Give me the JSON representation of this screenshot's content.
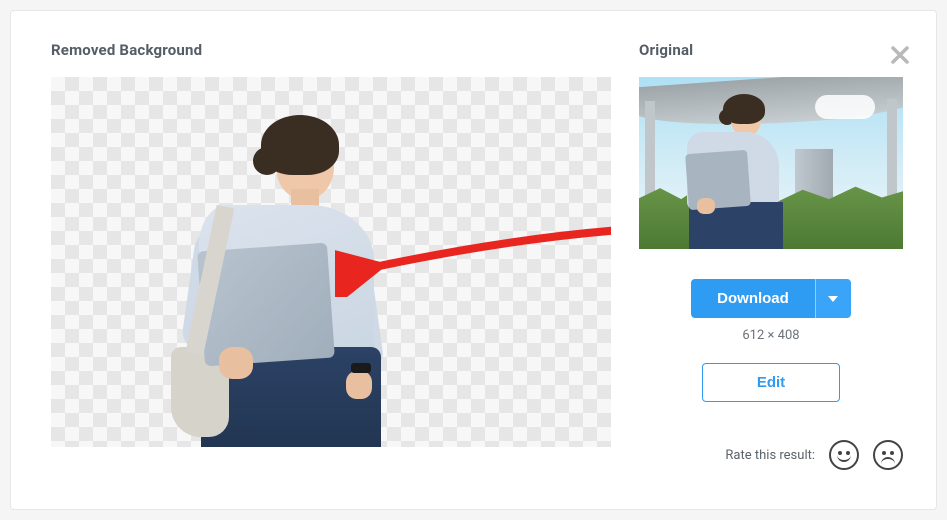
{
  "labels": {
    "removed_title": "Removed Background",
    "original_title": "Original",
    "download": "Download",
    "edit": "Edit",
    "dimensions": "612 × 408",
    "rate_prompt": "Rate this result:"
  },
  "icons": {
    "close": "close-icon",
    "caret": "caret-down-icon",
    "smile": "smile-face-icon",
    "frown": "frown-face-icon",
    "arrow": "red-arrow-icon"
  },
  "colors": {
    "accent": "#2f9cf4",
    "arrow": "#e8261f"
  }
}
